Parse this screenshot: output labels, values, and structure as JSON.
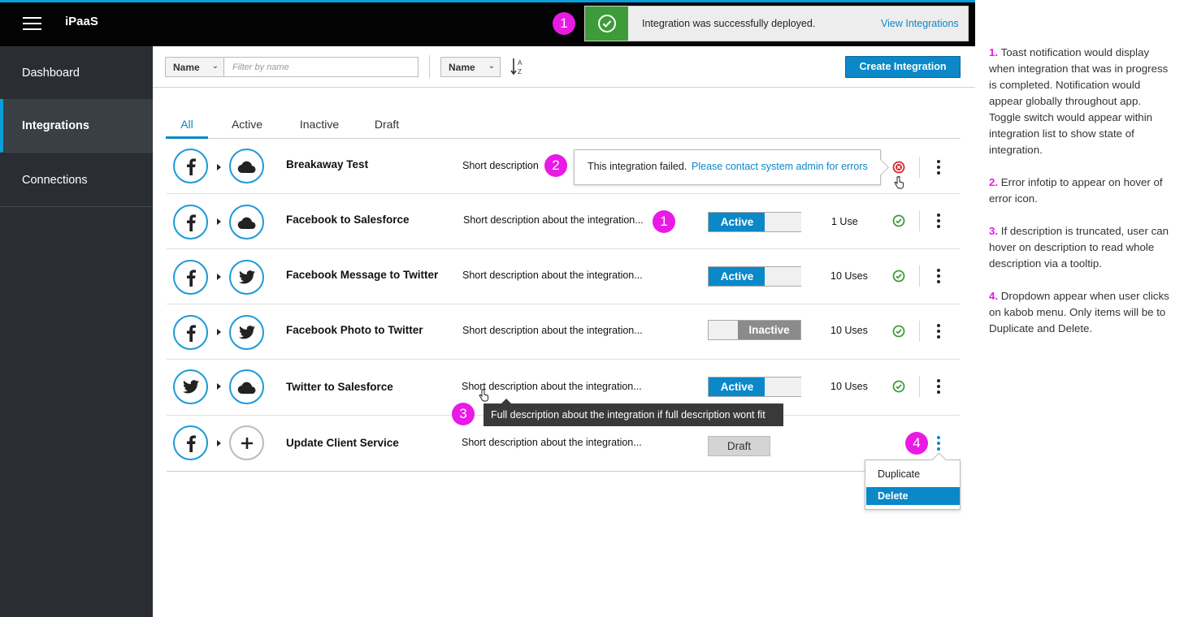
{
  "app": {
    "title": "iPaaS"
  },
  "sidebar": {
    "items": [
      {
        "label": "Dashboard"
      },
      {
        "label": "Integrations"
      },
      {
        "label": "Connections"
      }
    ]
  },
  "toolbar": {
    "filter_select": "Name",
    "filter_placeholder": "Filter by name",
    "sort_select": "Name",
    "create_label": "Create Integration"
  },
  "toast": {
    "badge": "1",
    "message": "Integration was successfully deployed.",
    "link": "View Integrations"
  },
  "tabs": [
    {
      "label": "All"
    },
    {
      "label": "Active"
    },
    {
      "label": "Inactive"
    },
    {
      "label": "Draft"
    }
  ],
  "rows": [
    {
      "name": "Breakaway Test",
      "description": "Short description",
      "status": "error"
    },
    {
      "name": "Facebook to Salesforce",
      "description": "Short description about the integration...",
      "toggle": "Active",
      "uses": "1 Use",
      "badge": "1"
    },
    {
      "name": "Facebook Message to Twitter",
      "description": "Short description about the integration...",
      "toggle": "Active",
      "uses": "10 Uses"
    },
    {
      "name": "Facebook Photo to Twitter",
      "description": "Short description about the integration...",
      "toggle": "Inactive",
      "uses": "10 Uses"
    },
    {
      "name": "Twitter to Salesforce",
      "description": "Short description about the integration...",
      "toggle": "Active",
      "uses": "10 Uses"
    },
    {
      "name": "Update Client Service",
      "description": "Short description about the integration...",
      "draft": "Draft"
    }
  ],
  "error_tip": {
    "badge": "2",
    "text": "This integration failed.",
    "link": "Please contact system admin for errors"
  },
  "tooltip": {
    "badge": "3",
    "text": "Full description about the integration if full description wont fit"
  },
  "kebab_menu": {
    "badge": "4",
    "items": [
      "Duplicate",
      "Delete"
    ]
  },
  "notes": [
    {
      "num": "1.",
      "text": "Toast notification would display when integration that was in progress is completed. Notification would appear globally throughout app. Toggle switch would appear within integration list to show state of integration."
    },
    {
      "num": "2.",
      "text": "Error infotip to appear on hover of error icon."
    },
    {
      "num": "3.",
      "text": "If description is truncated, user can hover on description to read whole description via a tooltip."
    },
    {
      "num": "4.",
      "text": "Dropdown appear when user clicks on kabob menu. Only items will be to Duplicate and Delete."
    }
  ],
  "colors": {
    "accent": "#0a88c8",
    "success": "#3e9b3a",
    "error": "#d9242f",
    "annotation": "#e919e6",
    "sidebar": "#2a2e33"
  },
  "icons": [
    "hamburger-icon",
    "sort-alpha-icon",
    "facebook-icon",
    "twitter-icon",
    "cloud-icon",
    "plus-icon",
    "check-circle-icon",
    "error-circle-icon",
    "kebab-icon"
  ]
}
